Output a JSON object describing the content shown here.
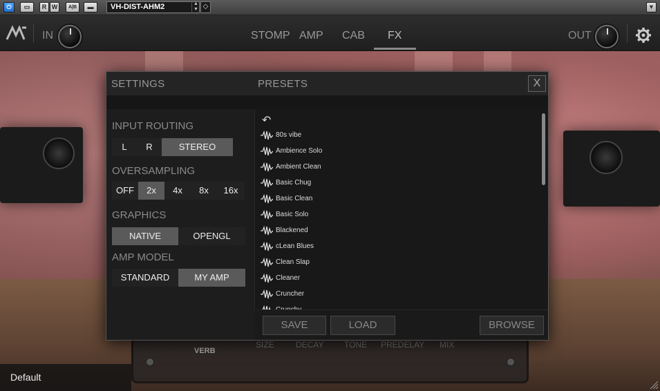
{
  "host": {
    "buttons": [
      "R",
      "W",
      "A|B"
    ],
    "preset_name": "VH-DIST-AHM2"
  },
  "header": {
    "in_label": "IN",
    "out_label": "OUT",
    "tabs": [
      "STOMP",
      "AMP",
      "CAB",
      "FX"
    ],
    "active_tab": "FX"
  },
  "modal": {
    "settings_title": "SETTINGS",
    "presets_title": "PRESETS",
    "close_label": "X",
    "input_routing": {
      "label": "INPUT ROUTING",
      "options": [
        "L",
        "R",
        "STEREO"
      ],
      "selected": "STEREO"
    },
    "oversampling": {
      "label": "OVERSAMPLING",
      "options": [
        "OFF",
        "2x",
        "4x",
        "8x",
        "16x"
      ],
      "selected": "2x"
    },
    "graphics": {
      "label": "GRAPHICS",
      "options": [
        "NATIVE",
        "OPENGL"
      ],
      "selected": "NATIVE"
    },
    "amp_model": {
      "label": "AMP MODEL",
      "options": [
        "STANDARD",
        "MY AMP"
      ],
      "selected": "MY AMP"
    },
    "presets": [
      "80s vibe",
      "Ambience Solo",
      "Ambient Clean",
      "Basic Chug",
      "Basic Clean",
      "Basic Solo",
      "Blackened",
      "cLean Blues",
      "Clean Slap",
      "Cleaner",
      "Cruncher",
      "Crunchy"
    ],
    "save_label": "SAVE",
    "load_label": "LOAD",
    "browse_label": "BROWSE"
  },
  "amp": {
    "section_label": "VERB",
    "params": [
      "SIZE",
      "DECAY",
      "TONE",
      "PREDELAY",
      "MIX"
    ]
  },
  "footer": {
    "label": "Default"
  }
}
